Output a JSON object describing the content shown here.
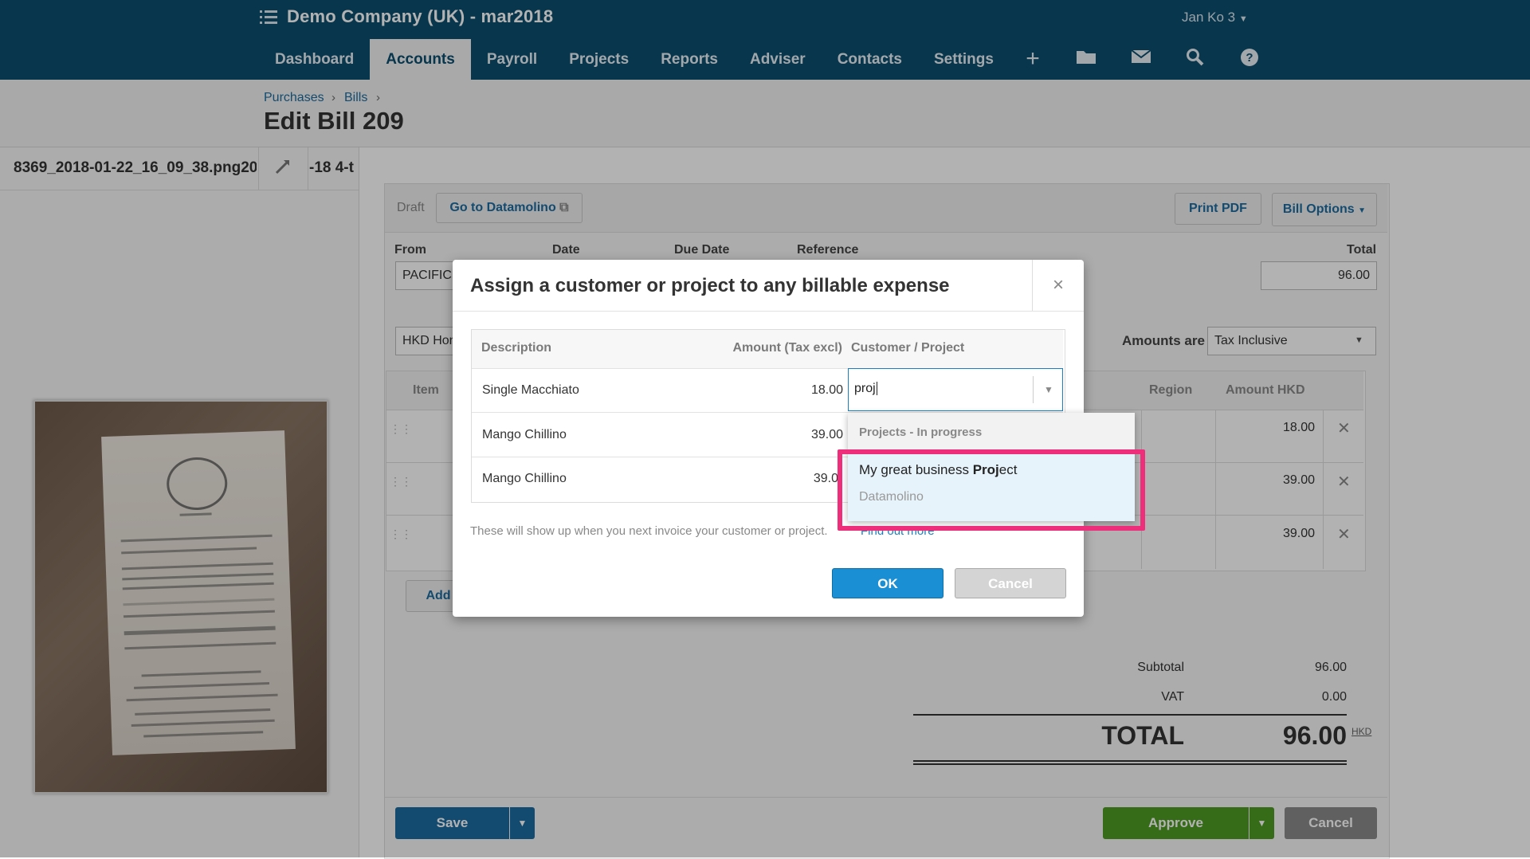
{
  "header": {
    "org_name": "Demo Company (UK) - mar2018",
    "user": "Jan Ko 3",
    "nav_tabs": [
      "Dashboard",
      "Accounts",
      "Payroll",
      "Projects",
      "Reports",
      "Adviser",
      "Contacts",
      "Settings"
    ],
    "active_tab": "Accounts",
    "icons": [
      "plus-icon",
      "folder-icon",
      "mail-icon",
      "search-icon",
      "help-icon"
    ]
  },
  "breadcrumb": {
    "item1": "Purchases",
    "item2": "Bills",
    "sep": "›"
  },
  "page": {
    "title": "Edit Bill 209"
  },
  "attachment": {
    "file_name": "8369_2018-01-22_16_09_38.png20",
    "file_suffix": "-18 4-t"
  },
  "bill": {
    "status": "Draft",
    "go_to_label": "Go to Datamolino",
    "print_pdf": "Print PDF",
    "bill_options": "Bill Options",
    "labels": {
      "from": "From",
      "date": "Date",
      "due_date": "Due Date",
      "reference": "Reference",
      "total": "Total"
    },
    "from_value": "PACIFIC",
    "total_value": "96.00",
    "currency_value": "HKD Hon",
    "amounts_are_label": "Amounts are",
    "amounts_are_value": "Tax Inclusive",
    "columns": {
      "item": "Item",
      "region": "Region",
      "amount": "Amount HKD"
    },
    "line_amounts": [
      "18.00",
      "39.00",
      "39.00"
    ],
    "add_label": "Add",
    "subtotal_label": "Subtotal",
    "subtotal_value": "96.00",
    "vat_label": "VAT",
    "vat_value": "0.00",
    "total_label": "TOTAL",
    "total_big": "96.00",
    "currency": "HKD",
    "save": "Save",
    "approve": "Approve",
    "cancel": "Cancel"
  },
  "modal": {
    "title": "Assign a customer or project to any billable expense",
    "close": "×",
    "columns": {
      "description": "Description",
      "amount": "Amount (Tax excl)",
      "customer": "Customer / Project"
    },
    "rows": [
      {
        "description": "Single Macchiato",
        "amount": "18.00"
      },
      {
        "description": "Mango Chillino",
        "amount": "39.00"
      },
      {
        "description": "Mango Chillino",
        "amount": "39.0"
      }
    ],
    "search_value": "proj",
    "hint": "These will show up when you next invoice your customer or project.",
    "hint_link": "Find out more",
    "ok": "OK",
    "cancel": "Cancel"
  },
  "dropdown": {
    "group": "Projects - In progress",
    "item_title_prefix": "My great business ",
    "item_title_match": "Proj",
    "item_title_suffix": "ect",
    "item_sub": "Datamolino"
  },
  "colors": {
    "topbar": "#0b4e6f",
    "primary": "#1a8fd4",
    "approve": "#4e9a21",
    "highlight": "#ee2d7b"
  }
}
